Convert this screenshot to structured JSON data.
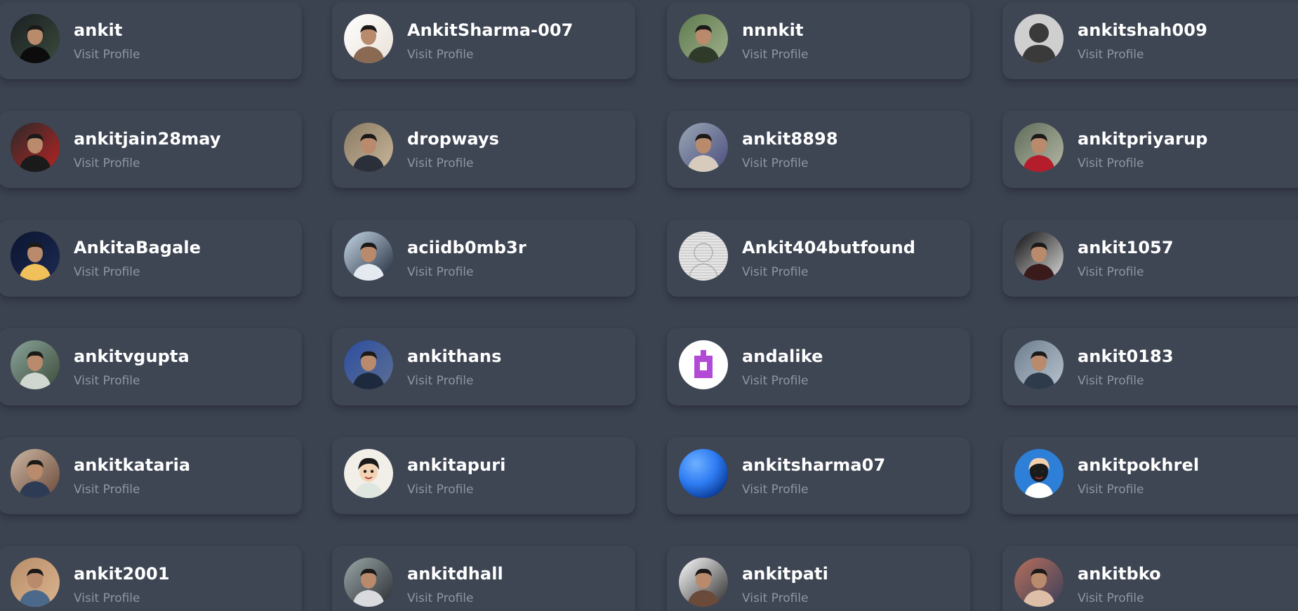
{
  "visit_label": "Visit Profile",
  "users": [
    {
      "username": "ankit",
      "avatar": "photo-dark-masked",
      "colors": [
        "#1b1f22",
        "#3a4b3c",
        "#0c0c0c"
      ]
    },
    {
      "username": "AnkitSharma-007",
      "avatar": "photo-white-experts",
      "colors": [
        "#ffffff",
        "#e9e1d7",
        "#8a6a52"
      ]
    },
    {
      "username": "nnnkit",
      "avatar": "photo-outdoor",
      "colors": [
        "#5f7a4d",
        "#9fb08c",
        "#2f3a2a"
      ]
    },
    {
      "username": "ankitshah009",
      "avatar": "default-silhouette",
      "colors": [
        "#cfcfcf",
        "#3a3a3a",
        "#3a3a3a"
      ]
    },
    {
      "username": "ankitjain28may",
      "avatar": "photo-red-shirt",
      "colors": [
        "#2a2a2a",
        "#b82323",
        "#1a1a1a"
      ]
    },
    {
      "username": "dropways",
      "avatar": "photo-indoor",
      "colors": [
        "#8a7a64",
        "#c8b79a",
        "#2a2f3a"
      ]
    },
    {
      "username": "ankit8898",
      "avatar": "photo-plaid-shirt",
      "colors": [
        "#9aa7b5",
        "#4a4d7e",
        "#d6cbbd"
      ]
    },
    {
      "username": "ankitpriyarup",
      "avatar": "photo-glasses-red",
      "colors": [
        "#5f6b5a",
        "#b5b8a5",
        "#b41d2c"
      ]
    },
    {
      "username": "AnkitaBagale",
      "avatar": "photo-night-lights",
      "colors": [
        "#0b1530",
        "#1d2a52",
        "#f0c15a"
      ]
    },
    {
      "username": "aciidb0mb3r",
      "avatar": "photo-suit-blue",
      "colors": [
        "#c7d7e6",
        "#1f2a3b",
        "#e4eaf0"
      ]
    },
    {
      "username": "Ankit404butfound",
      "avatar": "sketch-striped",
      "colors": [
        "#e6e6e6",
        "#bdbdbd",
        "#f4f4f4"
      ]
    },
    {
      "username": "ankit1057",
      "avatar": "photo-stage-dark",
      "colors": [
        "#101012",
        "#d9d9d9",
        "#3a1a1a"
      ]
    },
    {
      "username": "ankitvgupta",
      "avatar": "photo-park",
      "colors": [
        "#8aa39a",
        "#3c4c3a",
        "#cfd7d0"
      ]
    },
    {
      "username": "ankithans",
      "avatar": "photo-blue-bg",
      "colors": [
        "#2c4ea0",
        "#5c6f93",
        "#1d2a3e"
      ]
    },
    {
      "username": "andalike",
      "avatar": "logo-purple-block",
      "colors": [
        "#ffffff",
        "#b14bd6",
        "#ffffff"
      ]
    },
    {
      "username": "ankit0183",
      "avatar": "photo-street",
      "colors": [
        "#6d7d8e",
        "#b8c3cf",
        "#2d3b4b"
      ]
    },
    {
      "username": "ankitkataria",
      "avatar": "photo-crowd",
      "colors": [
        "#cbb6a2",
        "#6b4a3a",
        "#2d3b55"
      ]
    },
    {
      "username": "ankitapuri",
      "avatar": "cartoon-girl",
      "colors": [
        "#f1efe7",
        "#1a1a1a",
        "#f2d3b3"
      ]
    },
    {
      "username": "ankitsharma07",
      "avatar": "gradient-blue-orb",
      "colors": [
        "#2f7cf3",
        "#0b3d9a",
        "#6eb1ff"
      ]
    },
    {
      "username": "ankitpokhrel",
      "avatar": "cartoon-boy",
      "colors": [
        "#2e7fd7",
        "#f1d0b0",
        "#1a1a1a"
      ]
    },
    {
      "username": "ankit2001",
      "avatar": "photo-sandstone",
      "colors": [
        "#b98e6a",
        "#d9b48f",
        "#4b6a8b"
      ]
    },
    {
      "username": "ankitdhall",
      "avatar": "photo-suit-grey",
      "colors": [
        "#9aa7a8",
        "#2a2d33",
        "#d8dadd"
      ]
    },
    {
      "username": "ankitpati",
      "avatar": "photo-formal-white",
      "colors": [
        "#ffffff",
        "#2a2a2a",
        "#6b4a3a"
      ]
    },
    {
      "username": "ankitbko",
      "avatar": "photo-group",
      "colors": [
        "#b76f5b",
        "#3a3f5a",
        "#dcbfa6"
      ]
    }
  ]
}
